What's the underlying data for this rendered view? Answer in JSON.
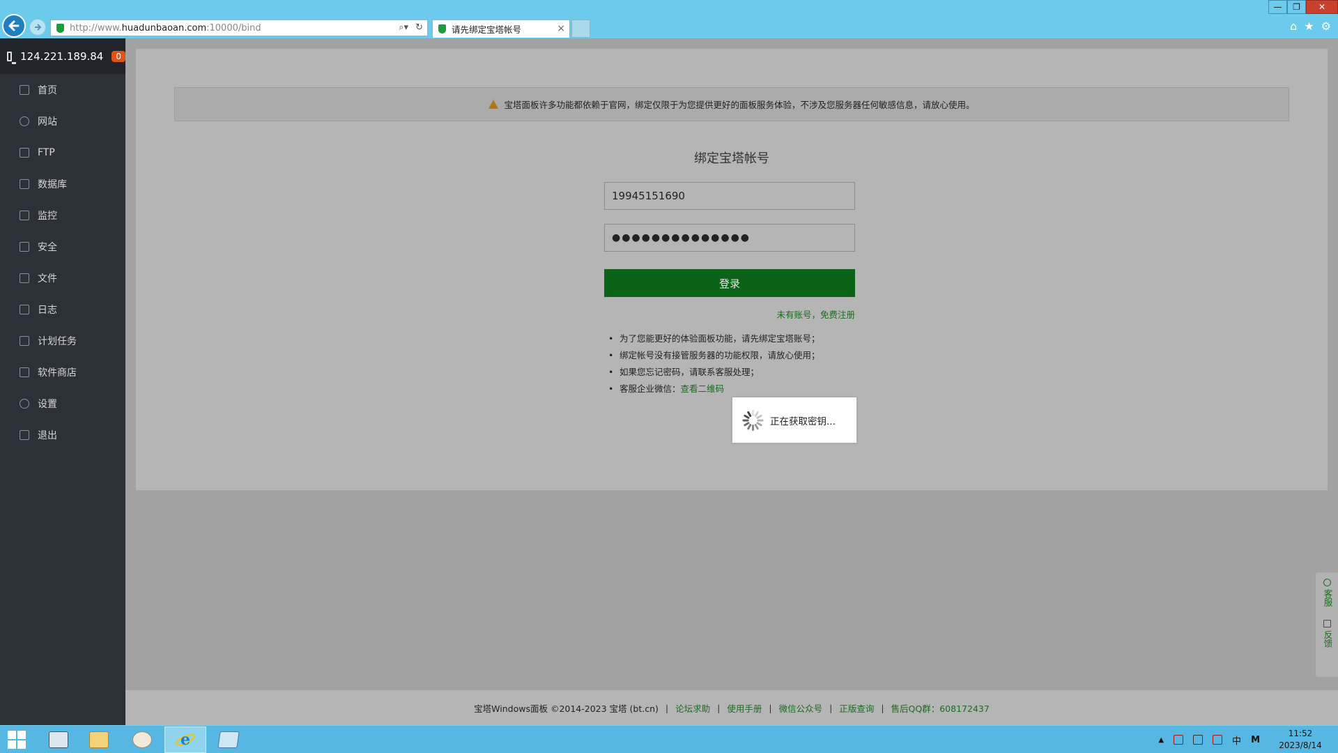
{
  "browser": {
    "url_prefix": "http://www.",
    "url_host": "huadunbaoan.com",
    "url_suffix": ":10000/bind",
    "tab_title": "请先绑定宝塔帐号",
    "tab_close": "×",
    "window_controls": {
      "minimize": "—",
      "restore": "❐",
      "close": "✕"
    }
  },
  "sidebar": {
    "server_ip": "124.221.189.84",
    "badge_count": "0",
    "items": [
      {
        "label": "首页",
        "icon": "home-icon"
      },
      {
        "label": "网站",
        "icon": "globe-icon"
      },
      {
        "label": "FTP",
        "icon": "ftp-icon"
      },
      {
        "label": "数据库",
        "icon": "database-icon"
      },
      {
        "label": "监控",
        "icon": "monitor-chart-icon"
      },
      {
        "label": "安全",
        "icon": "shield-icon"
      },
      {
        "label": "文件",
        "icon": "folder-icon"
      },
      {
        "label": "日志",
        "icon": "log-icon"
      },
      {
        "label": "计划任务",
        "icon": "calendar-icon"
      },
      {
        "label": "软件商店",
        "icon": "apps-grid-icon"
      },
      {
        "label": "设置",
        "icon": "gear-icon"
      },
      {
        "label": "退出",
        "icon": "logout-icon"
      }
    ]
  },
  "notice": {
    "text": "宝塔面板许多功能都依赖于官网，绑定仅限于为您提供更好的面板服务体验，不涉及您服务器任何敏感信息，请放心使用。"
  },
  "bind_form": {
    "title": "绑定宝塔帐号",
    "username_value": "19945151690",
    "password_value": "●●●●●●●●●●●●●●",
    "login_label": "登录",
    "register_link": "未有账号，免费注册",
    "tips": [
      "为了您能更好的体验面板功能，请先绑定宝塔账号；",
      "绑定帐号没有接管服务器的功能权限，请放心使用；",
      "如果您忘记密码，请联系客服处理；"
    ],
    "tip_wechat_prefix": "客服企业微信：",
    "tip_wechat_link": "查看二维码"
  },
  "loading": {
    "text": "正在获取密钥..."
  },
  "footer": {
    "copyright": "宝塔Windows面板 ©2014-2023 宝塔 (bt.cn)",
    "links": [
      "论坛求助",
      "使用手册",
      "微信公众号",
      "正版查询",
      "售后QQ群：608172437"
    ],
    "separator": "|"
  },
  "float_side": {
    "service": "客服",
    "feedback": "反馈"
  },
  "taskbar": {
    "time": "11:52",
    "date": "2023/8/14",
    "ime": "中",
    "ime_mode": "M",
    "tray_arrow": "▲"
  }
}
